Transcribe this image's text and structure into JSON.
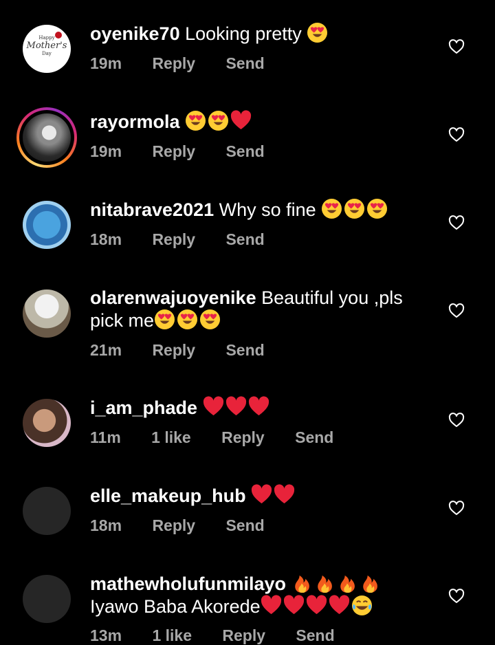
{
  "comments": [
    {
      "username": "oyenike70",
      "text": "Looking pretty",
      "emojis": [
        "heart-eyes"
      ],
      "time": "19m",
      "likes": "",
      "reply": "Reply",
      "send": "Send",
      "avatar_text": [
        "Happy",
        "Mother's",
        "Day"
      ]
    },
    {
      "username": "rayormola",
      "text": "",
      "emojis": [
        "heart-eyes",
        "heart-eyes",
        "red-heart"
      ],
      "time": "19m",
      "likes": "",
      "reply": "Reply",
      "send": "Send",
      "story_ring": true
    },
    {
      "username": "nitabrave2021",
      "text": "Why so fine",
      "emojis": [
        "heart-eyes",
        "heart-eyes",
        "heart-eyes"
      ],
      "time": "18m",
      "likes": "",
      "reply": "Reply",
      "send": "Send"
    },
    {
      "username": "olarenwajuoyenike",
      "text": "Beautiful you ,pls",
      "text2": "pick me",
      "emojis": [
        "heart-eyes",
        "heart-eyes",
        "heart-eyes"
      ],
      "time": "21m",
      "likes": "",
      "reply": "Reply",
      "send": "Send"
    },
    {
      "username": "i_am_phade",
      "text": "",
      "emojis": [
        "red-heart",
        "red-heart",
        "red-heart"
      ],
      "time": "11m",
      "likes": "1 like",
      "reply": "Reply",
      "send": "Send"
    },
    {
      "username": "elle_makeup_hub",
      "text": "",
      "emojis": [
        "red-heart",
        "red-heart"
      ],
      "time": "18m",
      "likes": "",
      "reply": "Reply",
      "send": "Send"
    },
    {
      "username": "mathewholufunmilayo",
      "text": "",
      "emojis": [
        "fire",
        "fire",
        "fire",
        "fire"
      ],
      "text2": "Iyawo Baba Akorede",
      "emojis2": [
        "red-heart",
        "red-heart",
        "red-heart",
        "red-heart",
        "joy"
      ],
      "time": "13m",
      "likes": "1 like",
      "reply": "Reply",
      "send": "Send"
    }
  ],
  "colors": {
    "background": "#000000",
    "meta_text": "#a8a8a8",
    "story_ring": [
      "#feda75",
      "#fa7e1e",
      "#d62976",
      "#962fbf"
    ]
  }
}
